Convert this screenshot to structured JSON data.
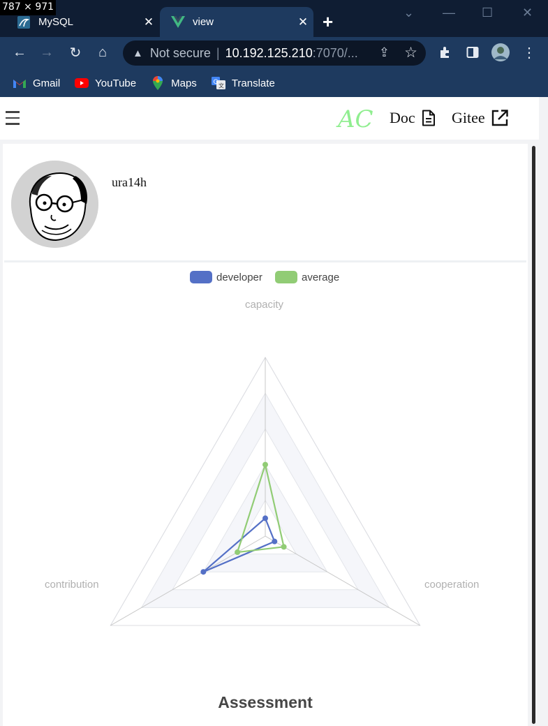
{
  "screenshot_label": "787 × 971",
  "browser": {
    "tabs": [
      {
        "title": "MySQL",
        "icon": "mysql-icon",
        "active": false
      },
      {
        "title": "view",
        "icon": "vue-icon",
        "active": true
      }
    ],
    "address": {
      "security": "Not secure",
      "host": "10.192.125.210",
      "rest": ":7070/..."
    },
    "bookmarks": [
      {
        "label": "Gmail",
        "icon": "gmail-icon"
      },
      {
        "label": "YouTube",
        "icon": "youtube-icon"
      },
      {
        "label": "Maps",
        "icon": "maps-icon"
      },
      {
        "label": "Translate",
        "icon": "translate-icon"
      }
    ]
  },
  "app": {
    "logo": "AC",
    "nav": {
      "doc": "Doc",
      "gitee": "Gitee"
    },
    "username": "ura14h"
  },
  "colors": {
    "developer": "#5470c6",
    "average": "#91cc75",
    "logo": "#90ee90"
  },
  "chart_data": {
    "type": "radar",
    "title": "Assessment",
    "legend": [
      "developer",
      "average"
    ],
    "legend_position": "top-center",
    "indicators": [
      {
        "name": "capacity"
      },
      {
        "name": "cooperation"
      },
      {
        "name": "contribution"
      }
    ],
    "series": [
      {
        "name": "developer",
        "values": [
          0.5,
          0.3,
          2.0
        ]
      },
      {
        "name": "average",
        "values": [
          2.0,
          0.6,
          0.9
        ]
      }
    ],
    "max": 5,
    "split_number": 5
  }
}
